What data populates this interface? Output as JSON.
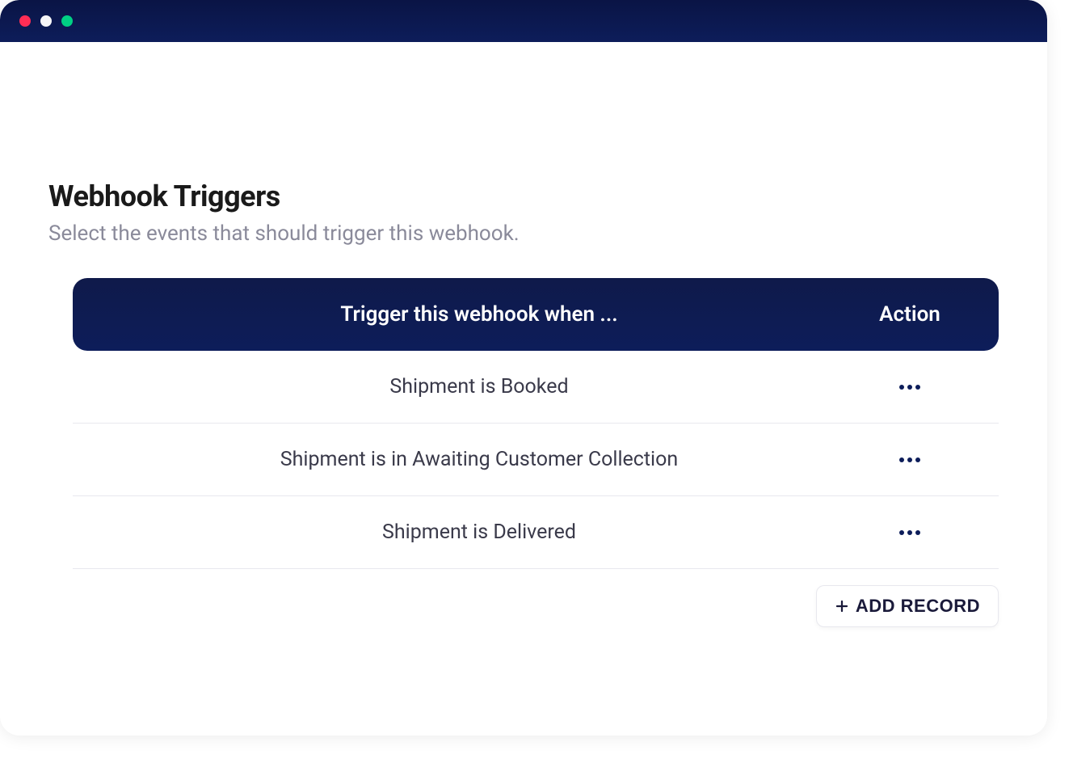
{
  "header": {
    "title": "Webhook Triggers",
    "subtitle": "Select the events that should trigger this webhook."
  },
  "table": {
    "columns": {
      "trigger": "Trigger this webhook when ...",
      "action": "Action"
    },
    "rows": [
      {
        "trigger": "Shipment is Booked"
      },
      {
        "trigger": "Shipment is in Awaiting Customer Collection"
      },
      {
        "trigger": "Shipment is Delivered"
      }
    ]
  },
  "actions": {
    "add_record": "ADD RECORD"
  },
  "colors": {
    "header_bg": "#0d1d5a",
    "subtitle": "#8a8a9a",
    "row_text": "#3a3a4a"
  }
}
